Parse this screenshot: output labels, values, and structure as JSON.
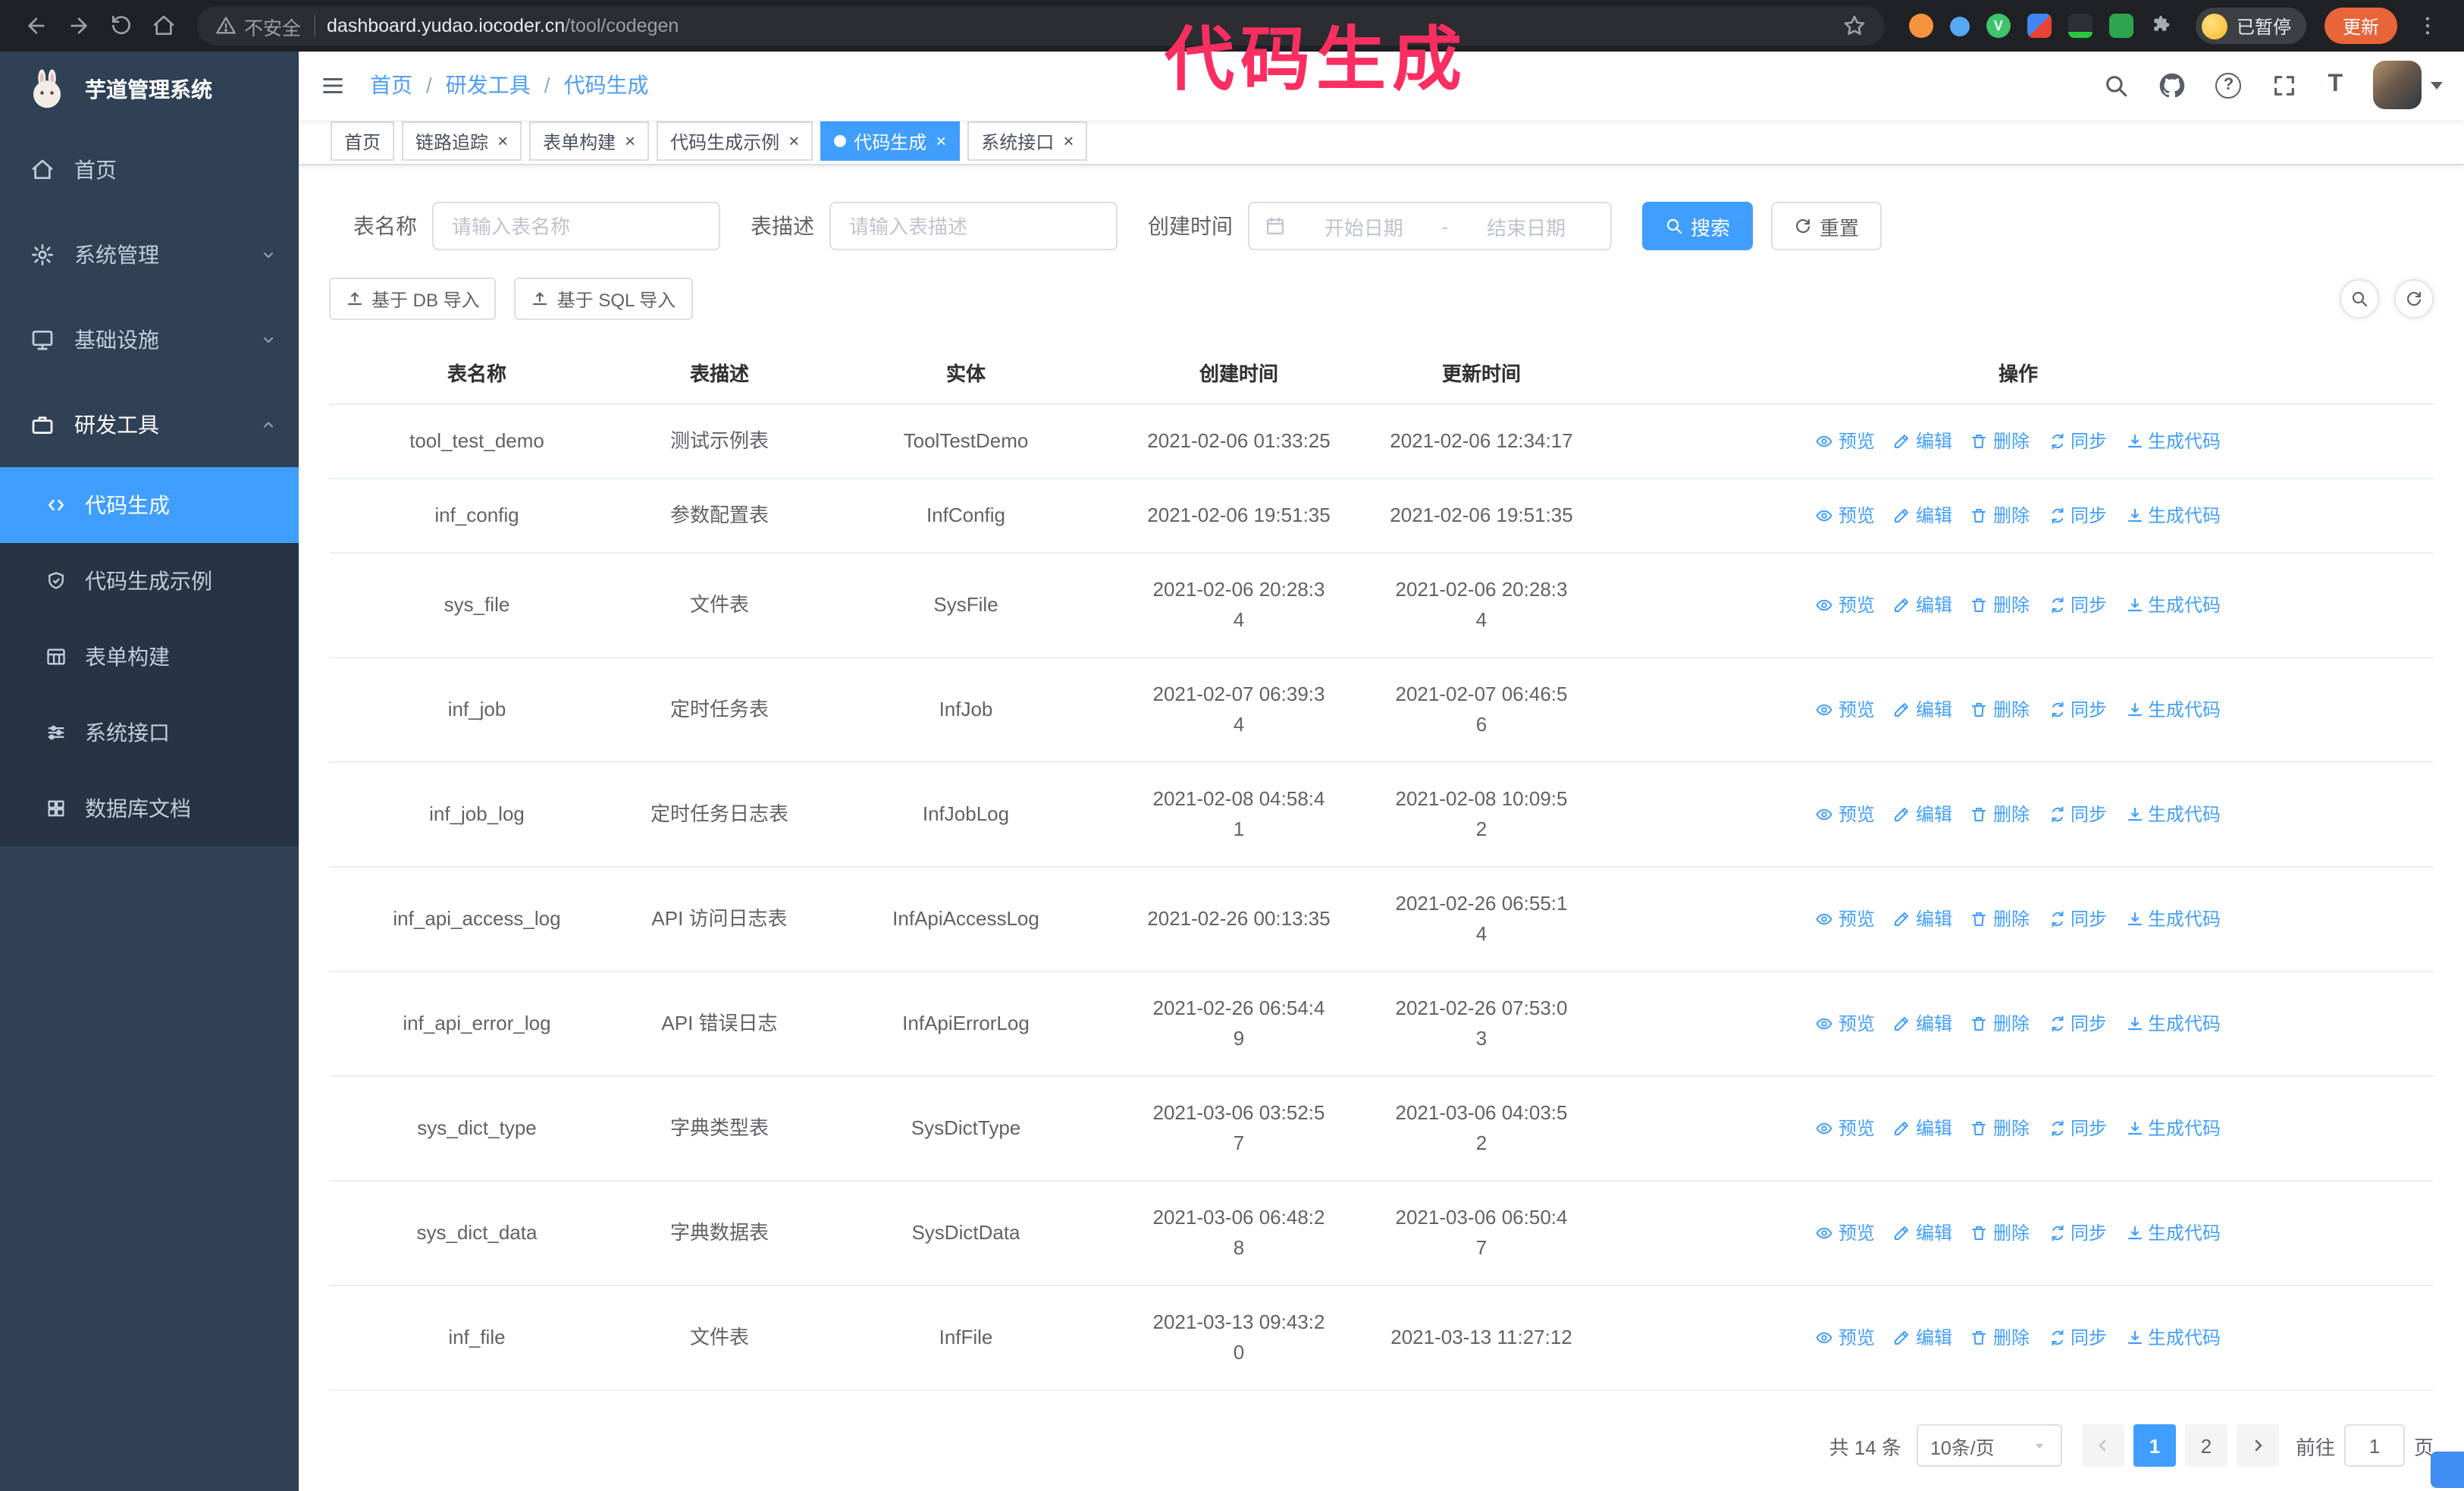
{
  "annotation": {
    "text": "代码生成"
  },
  "browser": {
    "security_label": "不安全",
    "url_host": "dashboard.yudao.iocoder.cn",
    "url_path": "/tool/codegen",
    "profile_status": "已暂停",
    "update_label": "更新"
  },
  "sidebar": {
    "title": "芋道管理系统",
    "menu": [
      {
        "label": "首页"
      },
      {
        "label": "系统管理"
      },
      {
        "label": "基础设施"
      },
      {
        "label": "研发工具"
      }
    ],
    "submenu": [
      {
        "label": "代码生成",
        "active": true
      },
      {
        "label": "代码生成示例"
      },
      {
        "label": "表单构建"
      },
      {
        "label": "系统接口"
      },
      {
        "label": "数据库文档"
      }
    ]
  },
  "header": {
    "breadcrumb": [
      "首页",
      "研发工具",
      "代码生成"
    ],
    "separator": "/"
  },
  "tabs": [
    {
      "label": "首页",
      "closable": false,
      "active": false
    },
    {
      "label": "链路追踪",
      "closable": true,
      "active": false
    },
    {
      "label": "表单构建",
      "closable": true,
      "active": false
    },
    {
      "label": "代码生成示例",
      "closable": true,
      "active": false
    },
    {
      "label": "代码生成",
      "closable": true,
      "active": true
    },
    {
      "label": "系统接口",
      "closable": true,
      "active": false
    }
  ],
  "filters": {
    "name_label": "表名称",
    "name_placeholder": "请输入表名称",
    "desc_label": "表描述",
    "desc_placeholder": "请输入表描述",
    "time_label": "创建时间",
    "start_placeholder": "开始日期",
    "range_separator": "-",
    "end_placeholder": "结束日期",
    "search_label": "搜索",
    "reset_label": "重置"
  },
  "toolbar": {
    "import_db_label": "基于 DB 导入",
    "import_sql_label": "基于 SQL 导入"
  },
  "table": {
    "columns": [
      "表名称",
      "表描述",
      "实体",
      "创建时间",
      "更新时间",
      "操作"
    ],
    "action_labels": {
      "preview": "预览",
      "edit": "编辑",
      "delete": "删除",
      "sync": "同步",
      "generate": "生成代码"
    },
    "rows": [
      {
        "name": "tool_test_demo",
        "desc": "测试示例表",
        "entity": "ToolTestDemo",
        "created": "2021-02-06 01:33:25",
        "updated": "2021-02-06 12:34:17"
      },
      {
        "name": "inf_config",
        "desc": "参数配置表",
        "entity": "InfConfig",
        "created": "2021-02-06 19:51:35",
        "updated": "2021-02-06 19:51:35"
      },
      {
        "name": "sys_file",
        "desc": "文件表",
        "entity": "SysFile",
        "created": "2021-02-06 20:28:3\n4",
        "updated": "2021-02-06 20:28:3\n4"
      },
      {
        "name": "inf_job",
        "desc": "定时任务表",
        "entity": "InfJob",
        "created": "2021-02-07 06:39:3\n4",
        "updated": "2021-02-07 06:46:5\n6"
      },
      {
        "name": "inf_job_log",
        "desc": "定时任务日志表",
        "entity": "InfJobLog",
        "created": "2021-02-08 04:58:4\n1",
        "updated": "2021-02-08 10:09:5\n2"
      },
      {
        "name": "inf_api_access_log",
        "desc": "API 访问日志表",
        "entity": "InfApiAccessLog",
        "created": "2021-02-26 00:13:35",
        "updated": "2021-02-26 06:55:1\n4"
      },
      {
        "name": "inf_api_error_log",
        "desc": "API 错误日志",
        "entity": "InfApiErrorLog",
        "created": "2021-02-26 06:54:4\n9",
        "updated": "2021-02-26 07:53:0\n3"
      },
      {
        "name": "sys_dict_type",
        "desc": "字典类型表",
        "entity": "SysDictType",
        "created": "2021-03-06 03:52:5\n7",
        "updated": "2021-03-06 04:03:5\n2"
      },
      {
        "name": "sys_dict_data",
        "desc": "字典数据表",
        "entity": "SysDictData",
        "created": "2021-03-06 06:48:2\n8",
        "updated": "2021-03-06 06:50:4\n7"
      },
      {
        "name": "inf_file",
        "desc": "文件表",
        "entity": "InfFile",
        "created": "2021-03-13 09:43:2\n0",
        "updated": "2021-03-13 11:27:12"
      }
    ]
  },
  "pagination": {
    "total": "共 14 条",
    "page_size": "10条/页",
    "page1": "1",
    "page2": "2",
    "goto_label": "前往",
    "goto_value": "1",
    "page_unit": "页"
  },
  "colors": {
    "accent": "#409eff",
    "annotation": "#fb2e62",
    "sidebar_bg": "#304156",
    "active_menu_bg": "#409eff",
    "update_button": "#e8653a"
  }
}
